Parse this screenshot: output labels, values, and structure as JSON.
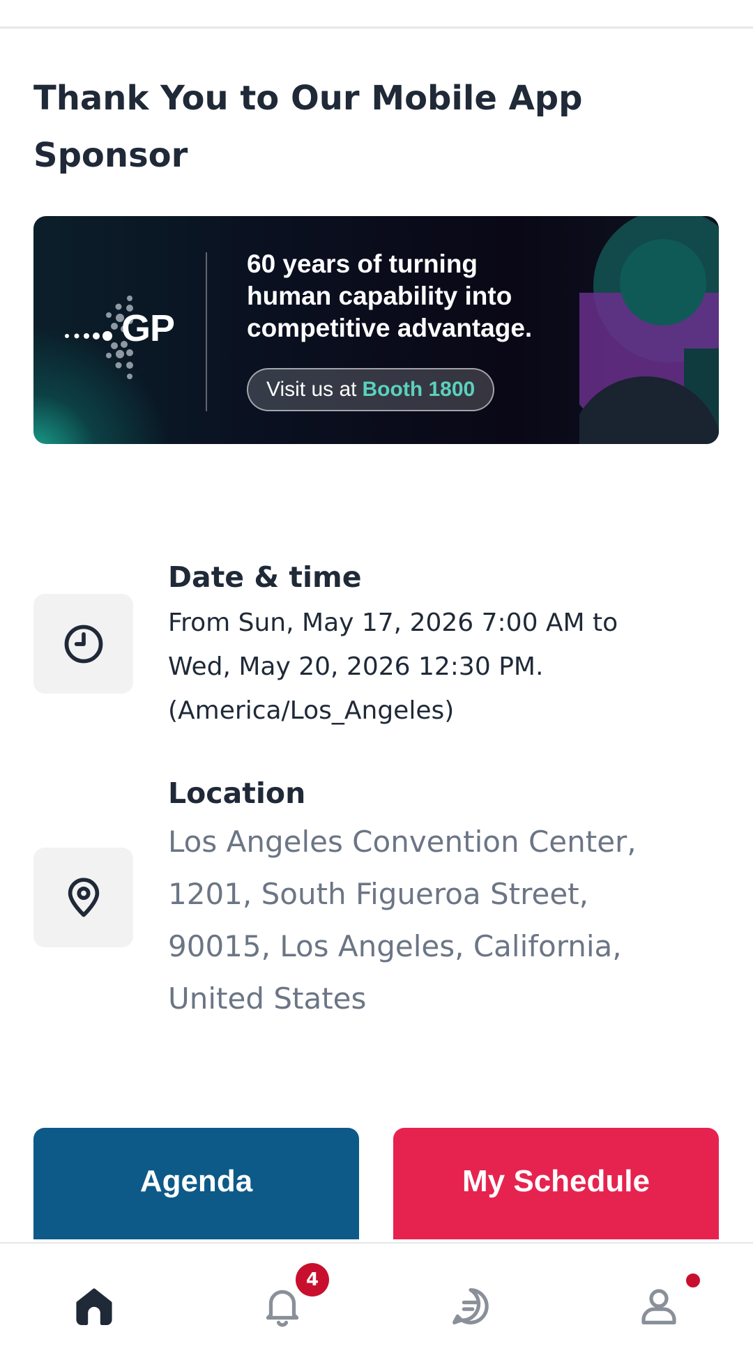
{
  "sponsor": {
    "heading": "Thank You to Our Mobile App Sponsor",
    "banner": {
      "logo_text": "GP",
      "tagline_lines": [
        "60 years of turning",
        "human capability into",
        "competitive advantage."
      ],
      "booth_prefix": "Visit us at",
      "booth_number": "Booth 1800"
    }
  },
  "event": {
    "date_time": {
      "title": "Date & time",
      "lines": [
        "From Sun, May 17, 2026 7:00 AM to",
        "Wed, May 20, 2026 12:30 PM.",
        "(America/Los_Angeles)"
      ],
      "icon": "clock-icon"
    },
    "location": {
      "title": "Location",
      "lines": [
        "Los Angeles Convention Center,",
        "1201, South Figueroa Street,",
        "90015, Los Angeles, California,",
        "United States"
      ],
      "icon": "location-pin-icon"
    }
  },
  "actions": {
    "agenda_label": "Agenda",
    "schedule_label": "My Schedule"
  },
  "bottom_nav": {
    "notifications_badge": "4",
    "items": [
      "home-icon",
      "bell-icon",
      "chat-icon",
      "profile-icon"
    ]
  },
  "colors": {
    "agenda": "#0d5a88",
    "schedule": "#e6234f",
    "badge": "#c8102e",
    "booth_accent": "#5ad1bd"
  }
}
